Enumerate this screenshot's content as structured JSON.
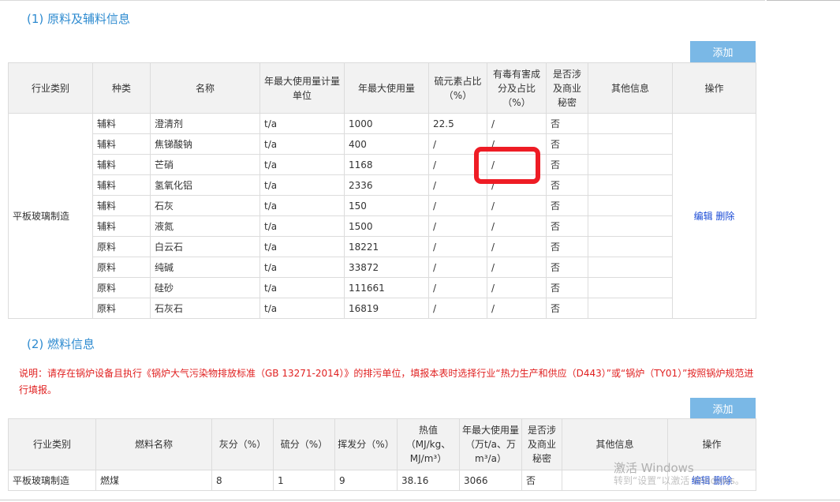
{
  "materials": {
    "title": "(1) 原料及辅料信息",
    "add_label": "添加",
    "headers": [
      "行业类别",
      "种类",
      "名称",
      "年最大使用量计量单位",
      "年最大使用量",
      "硫元素占比（%）",
      "有毒有害成分及占比（%）",
      "是否涉及商业秘密",
      "其他信息",
      "操作"
    ],
    "industry": "平板玻璃制造",
    "edit_label": "编辑",
    "delete_label": "删除",
    "rows": [
      {
        "kind": "辅料",
        "name": "澄清剂",
        "unit": "t/a",
        "amount": "1000",
        "sulfur": "22.5",
        "toxic": "/",
        "secret": "否"
      },
      {
        "kind": "辅料",
        "name": "焦锑酸钠",
        "unit": "t/a",
        "amount": "400",
        "sulfur": "/",
        "toxic": "/",
        "secret": "否"
      },
      {
        "kind": "辅料",
        "name": "芒硝",
        "unit": "t/a",
        "amount": "1168",
        "sulfur": "/",
        "toxic": "/",
        "secret": "否"
      },
      {
        "kind": "辅料",
        "name": "氢氧化铝",
        "unit": "t/a",
        "amount": "2336",
        "sulfur": "/",
        "toxic": "/",
        "secret": "否"
      },
      {
        "kind": "辅料",
        "name": "石灰",
        "unit": "t/a",
        "amount": "150",
        "sulfur": "/",
        "toxic": "/",
        "secret": "否"
      },
      {
        "kind": "辅料",
        "name": "液氮",
        "unit": "t/a",
        "amount": "1500",
        "sulfur": "/",
        "toxic": "/",
        "secret": "否"
      },
      {
        "kind": "原料",
        "name": "白云石",
        "unit": "t/a",
        "amount": "18221",
        "sulfur": "/",
        "toxic": "/",
        "secret": "否"
      },
      {
        "kind": "原料",
        "name": "纯碱",
        "unit": "t/a",
        "amount": "33872",
        "sulfur": "/",
        "toxic": "/",
        "secret": "否"
      },
      {
        "kind": "原料",
        "name": "硅砂",
        "unit": "t/a",
        "amount": "111661",
        "sulfur": "/",
        "toxic": "/",
        "secret": "否"
      },
      {
        "kind": "原料",
        "name": "石灰石",
        "unit": "t/a",
        "amount": "16819",
        "sulfur": "/",
        "toxic": "/",
        "secret": "否"
      }
    ]
  },
  "fuel": {
    "title": "(2) 燃料信息",
    "note": "说明：请存在锅炉设备且执行《锅炉大气污染物排放标准（GB 13271-2014）》的排污单位，填报本表时选择行业“热力生产和供应（D443）”或“锅炉（TY01）”按照锅炉规范进行填报。",
    "add_label": "添加",
    "headers": [
      "行业类别",
      "燃料名称",
      "灰分（%）",
      "硫分（%）",
      "挥发分（%）",
      "热值（MJ/kg、MJ/m³）",
      "年最大使用量（万t/a、万m³/a）",
      "是否涉及商业秘密",
      "其他信息",
      "操作"
    ],
    "edit_label": "编辑",
    "delete_label": "删除",
    "row": {
      "industry": "平板玻璃制造",
      "name": "燃煤",
      "ash": "8",
      "sulfur": "1",
      "volatile": "9",
      "heat": "38.16",
      "amount": "3066",
      "secret": "否",
      "other": ""
    }
  },
  "watermark": {
    "line1": "激活 Windows",
    "line2": "转到“设置”以激活 Windows。"
  }
}
